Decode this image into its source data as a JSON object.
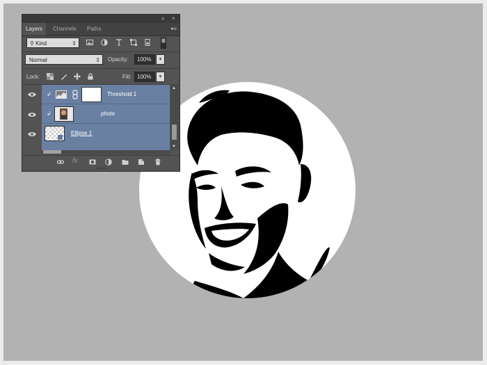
{
  "panel": {
    "collapse_glyph": "«",
    "close_glyph": "×",
    "tabs": [
      {
        "label": "Layers"
      },
      {
        "label": "Channels"
      },
      {
        "label": "Paths"
      }
    ],
    "menu_glyph": "▾≡",
    "filter": {
      "kind_label": "Kind",
      "filter_icons": [
        "image-filter-icon",
        "adjustment-filter-icon",
        "type-filter-icon",
        "shape-filter-icon",
        "smart-object-filter-icon",
        "filter-toggle-icon"
      ]
    },
    "blend_mode": "Normal",
    "opacity_label": "Opacity:",
    "opacity_value": "100%",
    "lock_label": "Lock:",
    "lock_icons": [
      "lock-transparent-icon",
      "lock-image-icon",
      "lock-position-icon",
      "lock-all-icon"
    ],
    "fill_label": "Fill:",
    "fill_value": "100%",
    "layers": [
      {
        "name": "Threshold 1",
        "type": "adjustment",
        "clipped": true,
        "visible": true
      },
      {
        "name": "photo",
        "type": "pixel",
        "clipped": true,
        "visible": true
      },
      {
        "name": "Ellipse 1",
        "type": "shape",
        "clipped": false,
        "visible": true
      }
    ],
    "bottom_icons": [
      "link-icon",
      "fx-icon",
      "mask-icon",
      "adjustment-icon",
      "folder-icon",
      "new-layer-icon",
      "trash-icon"
    ],
    "selected_color": "#6a80a2"
  },
  "canvas": {
    "background": "#b2b2b2",
    "shape_color": "#ffffff"
  }
}
